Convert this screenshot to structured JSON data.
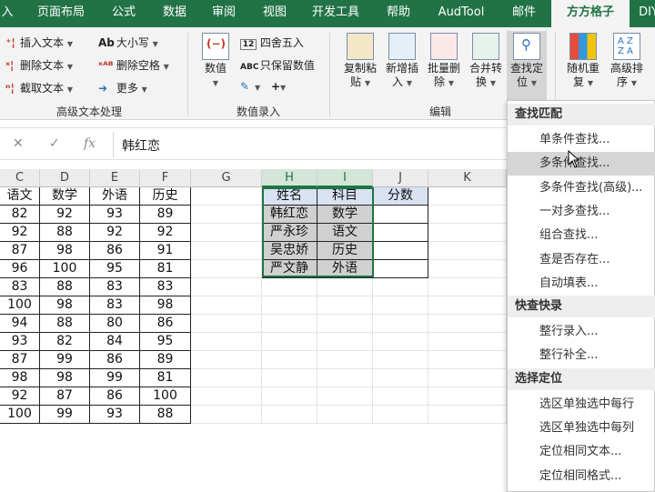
{
  "tabs": [
    "入",
    "页面布局",
    "公式",
    "数据",
    "审阅",
    "视图",
    "开发工具",
    "帮助",
    "AudTool",
    "邮件",
    "方方格子",
    "DIY"
  ],
  "active_tab": "方方格子",
  "ribbon": {
    "text_group": {
      "insert_text": "插入文本",
      "delete_text": "删除文本",
      "extract_text": "截取文本",
      "case": "大小写",
      "delete_space": "删除空格",
      "more": "更多",
      "label": "高级文本处理"
    },
    "number_group": {
      "numeric": "数值",
      "round": "四舍五入",
      "keep_numeric": "只保留数值",
      "label": "数值录入"
    },
    "edit_group": {
      "copy_paste": [
        "复制粘",
        "贴"
      ],
      "add_insert": [
        "新增插",
        "入"
      ],
      "batch_delete": [
        "批量删",
        "除"
      ],
      "merge_convert": [
        "合并转",
        "换"
      ],
      "find_locate": [
        "查找定",
        "位"
      ],
      "label": "编辑"
    },
    "random_group": {
      "random": [
        "随机重",
        "复"
      ],
      "sort": [
        "高级排",
        "序"
      ]
    }
  },
  "formula_bar": {
    "cancel": "✕",
    "confirm": "✓",
    "fx": "fx",
    "value": "韩红恋"
  },
  "columns": [
    "C",
    "D",
    "E",
    "F",
    "G",
    "H",
    "I",
    "J",
    "K"
  ],
  "table_left": {
    "headers": [
      "语文",
      "数学",
      "外语",
      "历史"
    ],
    "rows": [
      [
        "82",
        "92",
        "93",
        "89"
      ],
      [
        "92",
        "88",
        "92",
        "92"
      ],
      [
        "87",
        "98",
        "86",
        "91"
      ],
      [
        "96",
        "100",
        "95",
        "81"
      ],
      [
        "83",
        "88",
        "83",
        "83"
      ],
      [
        "100",
        "98",
        "83",
        "98"
      ],
      [
        "94",
        "88",
        "80",
        "86"
      ],
      [
        "93",
        "82",
        "84",
        "95"
      ],
      [
        "87",
        "99",
        "86",
        "89"
      ],
      [
        "98",
        "98",
        "99",
        "81"
      ],
      [
        "92",
        "87",
        "86",
        "100"
      ],
      [
        "100",
        "99",
        "93",
        "88"
      ]
    ]
  },
  "table_right": {
    "headers": [
      "姓名",
      "科目",
      "分数"
    ],
    "rows": [
      [
        "韩红恋",
        "数学",
        ""
      ],
      [
        "严永珍",
        "语文",
        ""
      ],
      [
        "吴忠娇",
        "历史",
        ""
      ],
      [
        "严文静",
        "外语",
        ""
      ]
    ]
  },
  "menu": {
    "sections": [
      {
        "header": "查找匹配",
        "items": [
          "单条件查找...",
          "多条件查找...",
          "多条件查找(高级)...",
          "一对多查找...",
          "组合查找...",
          "查是否存在...",
          "自动填表..."
        ]
      },
      {
        "header": "快查快录",
        "items": [
          "整行录入...",
          "整行补全..."
        ]
      },
      {
        "header": "选择定位",
        "items": [
          "选区单独选中每行",
          "选区单独选中每列",
          "定位相同文本...",
          "定位相同格式..."
        ]
      }
    ],
    "hover_item": "多条件查找..."
  }
}
